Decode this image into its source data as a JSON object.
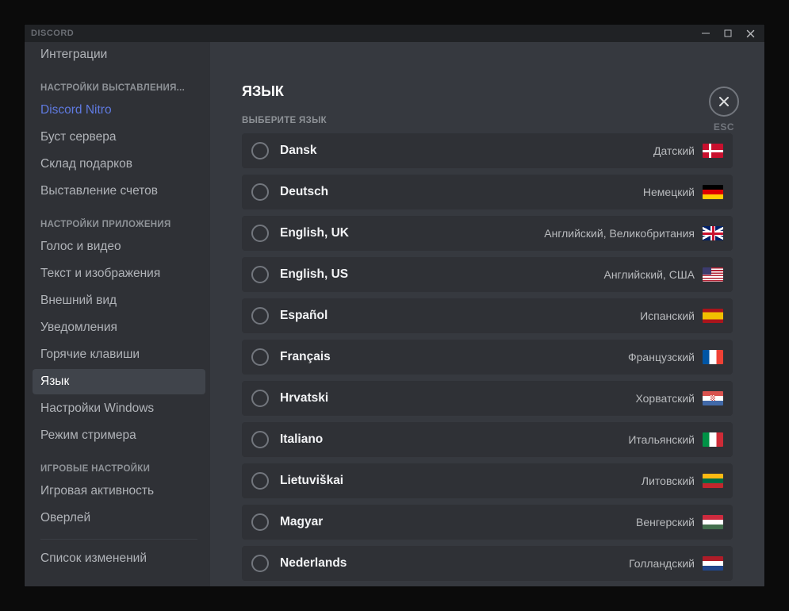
{
  "titlebar": {
    "brand": "DISCORD"
  },
  "sidebar": {
    "item_cut": "Интеграции",
    "header_billing": "НАСТРОЙКИ ВЫСТАВЛЕНИЯ...",
    "billing": {
      "nitro": "Discord Nitro",
      "boost": "Буст сервера",
      "gifts": "Склад подарков",
      "billing": "Выставление счетов"
    },
    "header_app": "НАСТРОЙКИ ПРИЛОЖЕНИЯ",
    "app": {
      "voice": "Голос и видео",
      "text": "Текст и изображения",
      "appearance": "Внешний вид",
      "notifications": "Уведомления",
      "hotkeys": "Горячие клавиши",
      "language": "Язык",
      "windows": "Настройки Windows",
      "streamer": "Режим стримера"
    },
    "header_game": "ИГРОВЫЕ НАСТРОЙКИ",
    "game": {
      "activity": "Игровая активность",
      "overlay": "Оверлей"
    },
    "changelog": "Список изменений"
  },
  "page": {
    "title": "ЯЗЫК",
    "subheader": "ВЫБЕРИТЕ ЯЗЫК",
    "esc": "ESC"
  },
  "languages": [
    {
      "native": "Dansk",
      "local": "Датский",
      "flag": "dk"
    },
    {
      "native": "Deutsch",
      "local": "Немецкий",
      "flag": "de"
    },
    {
      "native": "English, UK",
      "local": "Английский, Великобритания",
      "flag": "uk"
    },
    {
      "native": "English, US",
      "local": "Английский, США",
      "flag": "us"
    },
    {
      "native": "Español",
      "local": "Испанский",
      "flag": "es"
    },
    {
      "native": "Français",
      "local": "Французский",
      "flag": "fr"
    },
    {
      "native": "Hrvatski",
      "local": "Хорватский",
      "flag": "hr"
    },
    {
      "native": "Italiano",
      "local": "Итальянский",
      "flag": "it"
    },
    {
      "native": "Lietuviškai",
      "local": "Литовский",
      "flag": "lt"
    },
    {
      "native": "Magyar",
      "local": "Венгерский",
      "flag": "hu"
    },
    {
      "native": "Nederlands",
      "local": "Голландский",
      "flag": "nl"
    }
  ]
}
